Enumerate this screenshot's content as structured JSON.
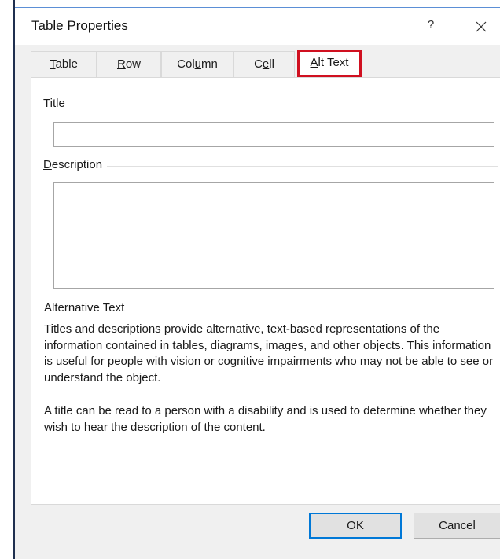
{
  "dialog": {
    "title": "Table Properties",
    "help_label": "?",
    "close_icon": "close-icon"
  },
  "tabs": [
    {
      "pre": "",
      "key": "T",
      "post": "able"
    },
    {
      "pre": "",
      "key": "R",
      "post": "ow"
    },
    {
      "pre": "Col",
      "key": "u",
      "post": "mn"
    },
    {
      "pre": "C",
      "key": "e",
      "post": "ll"
    },
    {
      "pre": "",
      "key": "A",
      "post": "lt Text"
    }
  ],
  "active_tab": "Alt Text",
  "alt_text": {
    "title_label": {
      "pre": "T",
      "key": "i",
      "post": "tle"
    },
    "title_value": "",
    "description_label": {
      "pre": "",
      "key": "D",
      "post": "escription"
    },
    "description_value": "",
    "heading": "Alternative Text",
    "para1": "Titles and descriptions provide alternative, text-based representations of the information contained in tables, diagrams, images, and other objects. This information is useful for people with vision or cognitive impairments who may not be able to see or understand the object.",
    "para2": "A title can be read to a person with a disability and is used to determine whether they wish to hear the description of the content."
  },
  "buttons": {
    "ok": "OK",
    "cancel": "Cancel"
  },
  "colors": {
    "highlight": "#d01020",
    "default_button_border": "#0078d7"
  }
}
